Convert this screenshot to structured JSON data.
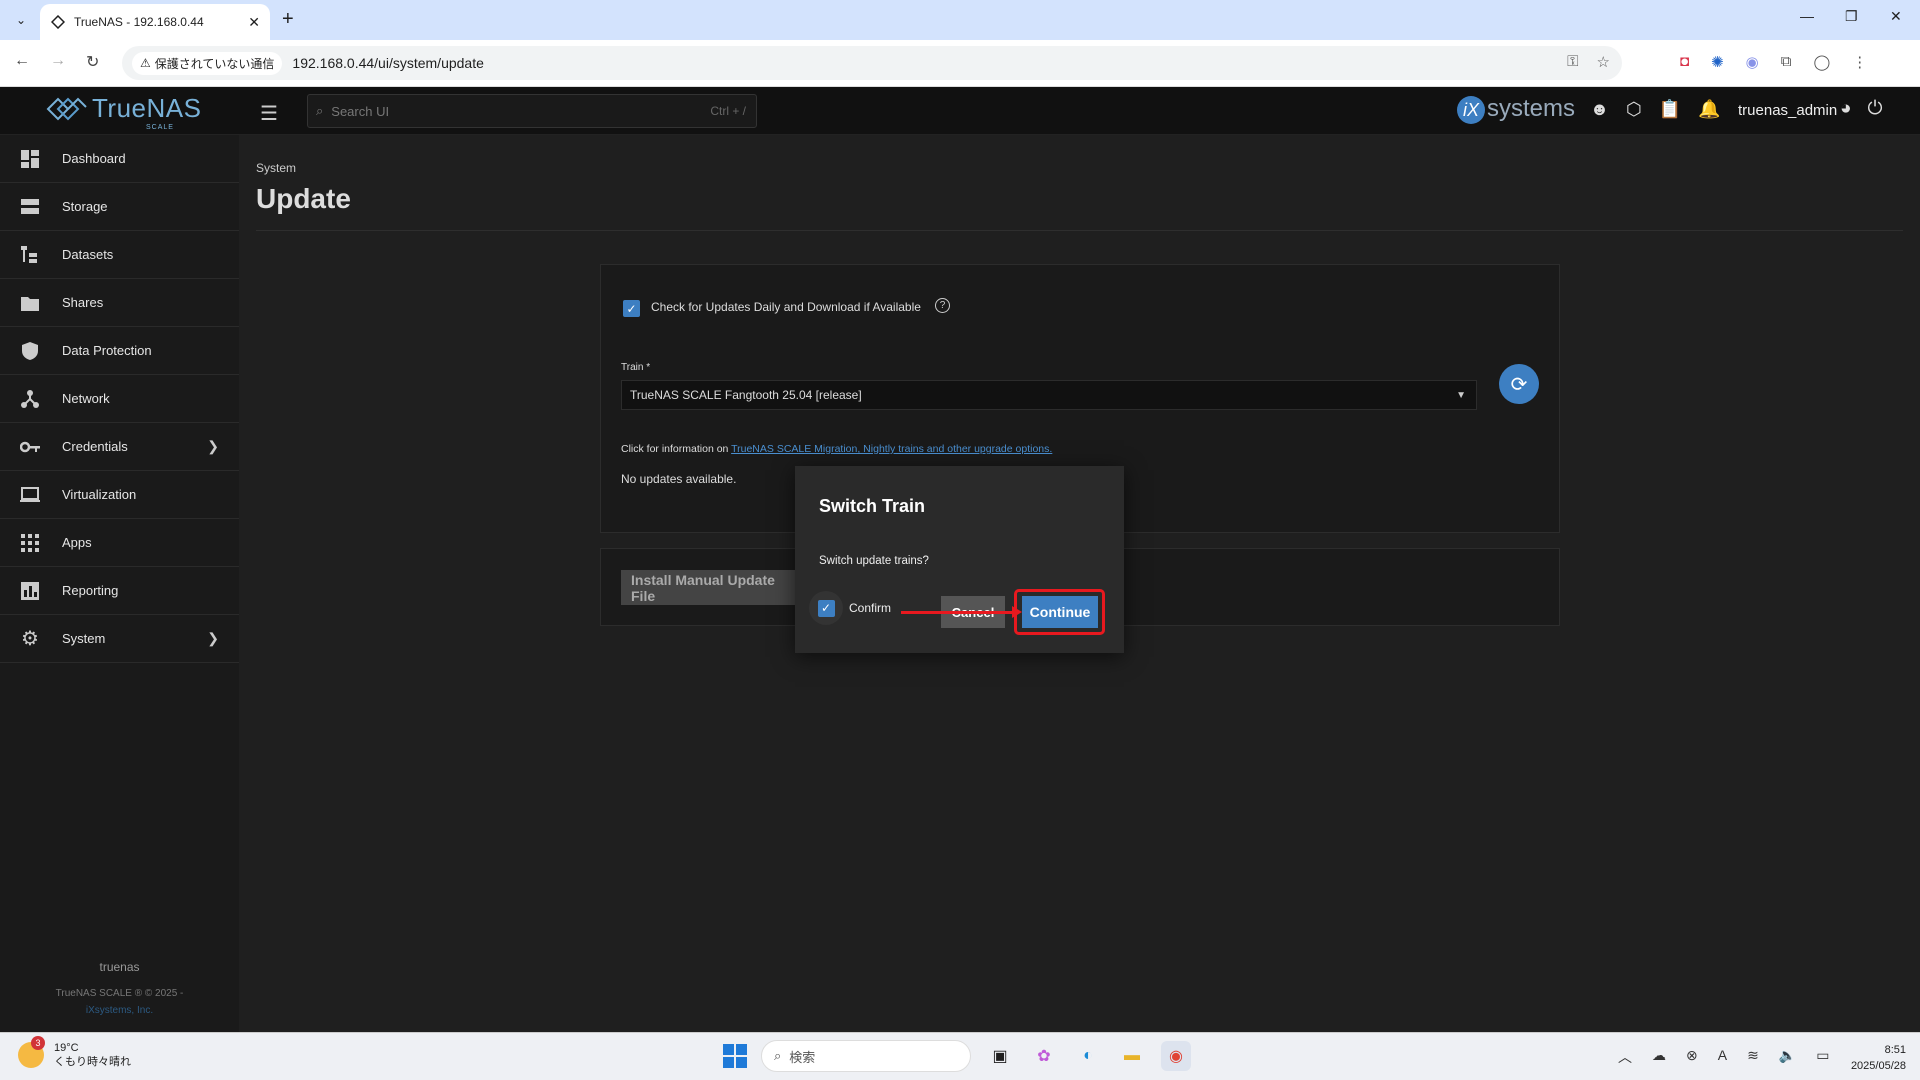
{
  "browser": {
    "tab_title": "TrueNAS - 192.168.0.44",
    "security_label": "保護されていない通信",
    "url": "192.168.0.44/ui/system/update"
  },
  "app": {
    "logo_text": "TrueNAS",
    "logo_sub": "SCALE",
    "search_placeholder": "Search UI",
    "search_shortcut": "Ctrl + /",
    "vendor": "systems",
    "vendor_mark": "iX",
    "username": "truenas_admin"
  },
  "sidebar": {
    "items": [
      {
        "label": "Dashboard",
        "icon": "dashboard-icon"
      },
      {
        "label": "Storage",
        "icon": "storage-icon"
      },
      {
        "label": "Datasets",
        "icon": "datasets-icon"
      },
      {
        "label": "Shares",
        "icon": "shares-icon"
      },
      {
        "label": "Data Protection",
        "icon": "shield-icon"
      },
      {
        "label": "Network",
        "icon": "network-icon"
      },
      {
        "label": "Credentials",
        "icon": "key-icon"
      },
      {
        "label": "Virtualization",
        "icon": "laptop-icon"
      },
      {
        "label": "Apps",
        "icon": "apps-grid-icon"
      },
      {
        "label": "Reporting",
        "icon": "bar-chart-icon"
      },
      {
        "label": "System",
        "icon": "gear-icon"
      }
    ],
    "hostname": "truenas",
    "copyright": "TrueNAS SCALE ® © 2025 -",
    "company": "iXsystems, Inc."
  },
  "page": {
    "breadcrumb": "System",
    "title": "Update",
    "auto_update_label": "Check for Updates Daily and Download if Available",
    "train_label": "Train *",
    "train_value": "TrueNAS SCALE Fangtooth 25.04 [release]",
    "info_prefix": "Click for information on ",
    "info_link": "TrueNAS SCALE Migration, Nightly trains and other upgrade options.",
    "status": "No updates available.",
    "manual_button": "Install Manual Update File"
  },
  "dialog": {
    "title": "Switch Train",
    "message": "Switch update trains?",
    "confirm_label": "Confirm",
    "cancel_label": "Cancel",
    "continue_label": "Continue"
  },
  "taskbar": {
    "temperature": "19°C",
    "weather": "くもり時々晴れ",
    "weather_badge": "3",
    "search_placeholder": "検索",
    "time": "8:51",
    "date": "2025/05/28"
  },
  "colors": {
    "accent": "#3d7fc2",
    "highlight": "#e8191f",
    "background": "#1f1f1f"
  }
}
